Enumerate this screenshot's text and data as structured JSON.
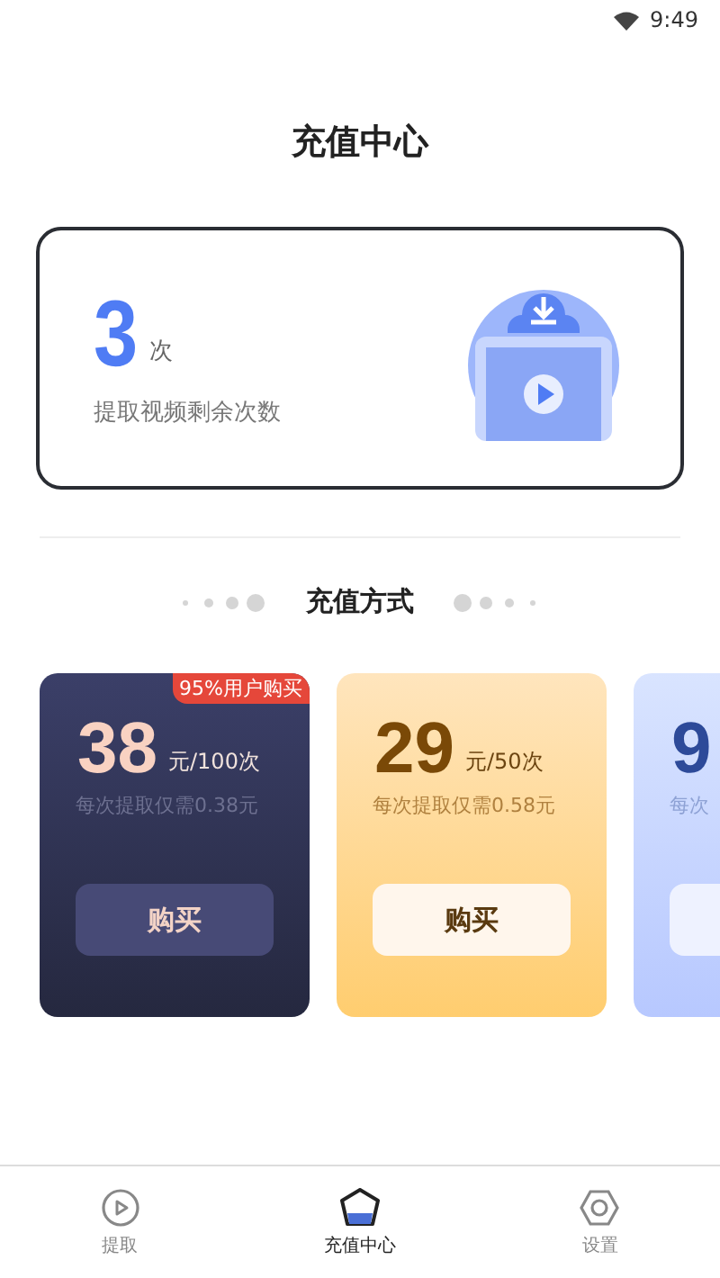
{
  "status_bar": {
    "time": "9:49"
  },
  "title": "充值中心",
  "balance": {
    "count": "3",
    "unit": "次",
    "caption": "提取视频剩余次数"
  },
  "section_title": "充值方式",
  "plans": [
    {
      "kind": "dark",
      "price": "38",
      "unit": "元/100次",
      "note": "每次提取仅需0.38元",
      "button": "购买",
      "badge": "95%用户购买"
    },
    {
      "kind": "gold",
      "price": "29",
      "unit": "元/50次",
      "note": "每次提取仅需0.58元",
      "button": "购买"
    },
    {
      "kind": "blue",
      "price": "9",
      "note": "每次"
    }
  ],
  "tabs": [
    {
      "kind": "play",
      "label": "提取",
      "selected": false
    },
    {
      "kind": "crown",
      "label": "充值中心",
      "selected": true
    },
    {
      "kind": "hex",
      "label": "设置",
      "selected": false
    }
  ]
}
